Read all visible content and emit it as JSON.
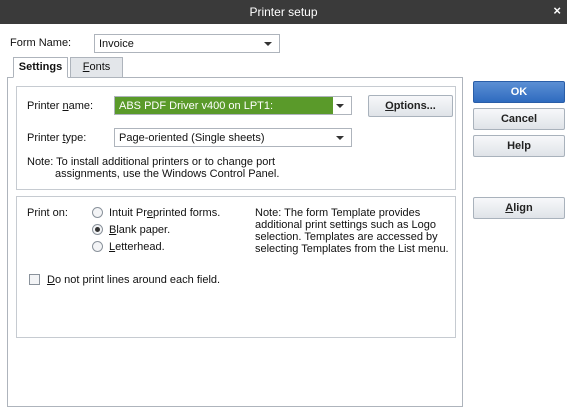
{
  "window": {
    "title": "Printer setup",
    "close_glyph": "×"
  },
  "form": {
    "label": "Form Name:",
    "value": "Invoice"
  },
  "tabs": [
    {
      "label": "Settings",
      "access_key": ""
    },
    {
      "label_prefix": "",
      "access_key": "F",
      "label_rest": "onts"
    }
  ],
  "printer": {
    "name_label_prefix": "Printer ",
    "name_label_key": "n",
    "name_label_rest": "ame:",
    "name_value": "ABS PDF Driver v400 on LPT1:",
    "type_label_prefix": "Printer ",
    "type_label_key": "t",
    "type_label_rest": "ype:",
    "type_value": "Page-oriented (Single sheets)",
    "options_prefix": "",
    "options_key": "O",
    "options_rest": "ptions...",
    "note_line1": "Note: To install additional printers or to change port",
    "note_line2": "assignments, use the Windows Control Panel."
  },
  "print_on": {
    "label": "Print on:",
    "options": [
      {
        "prefix": "Intuit Pr",
        "key": "e",
        "rest": "printed forms.",
        "checked": false
      },
      {
        "prefix": "",
        "key": "B",
        "rest": "lank paper.",
        "checked": true
      },
      {
        "prefix": "",
        "key": "L",
        "rest": "etterhead.",
        "checked": false
      }
    ],
    "note_lines": [
      "Note: The form Template provides",
      "additional print settings such as Logo",
      "selection.  Templates are accessed by",
      "selecting Templates from the List menu."
    ],
    "checkbox": {
      "prefix": "",
      "key": "D",
      "rest": "o not print lines around each field.",
      "checked": false
    }
  },
  "buttons": {
    "ok": "OK",
    "cancel": "Cancel",
    "help": "Help",
    "align_prefix": "",
    "align_key": "A",
    "align_rest": "lign"
  },
  "colors": {
    "titlebar": "#3a3a3a",
    "selected_printer_bg": "#5a9a2a",
    "primary_button": "#2f6bbf"
  }
}
